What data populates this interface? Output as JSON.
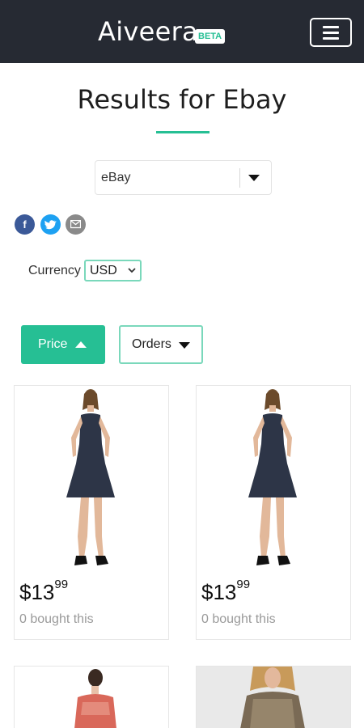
{
  "header": {
    "brand": "Aiveera",
    "badge": "BETA",
    "menu_icon": "hamburger-menu-icon"
  },
  "page": {
    "title": "Results for Ebay"
  },
  "store_select": {
    "value": "eBay"
  },
  "share": {
    "facebook": "f",
    "twitter": "t",
    "icons": [
      "facebook-icon",
      "twitter-icon",
      "email-icon"
    ]
  },
  "currency": {
    "label": "Currency",
    "value": "USD"
  },
  "sort": {
    "price_label": "Price",
    "orders_label": "Orders"
  },
  "products": [
    {
      "dollars": "$13",
      "cents": "99",
      "bought": "0 bought this"
    },
    {
      "dollars": "$13",
      "cents": "99",
      "bought": "0 bought this"
    },
    {
      "dollars": "",
      "cents": "",
      "bought": ""
    },
    {
      "dollars": "",
      "cents": "",
      "bought": ""
    }
  ],
  "colors": {
    "navbar": "#262a33",
    "accent": "#26bf94",
    "accent_border": "#7ad8bb"
  }
}
